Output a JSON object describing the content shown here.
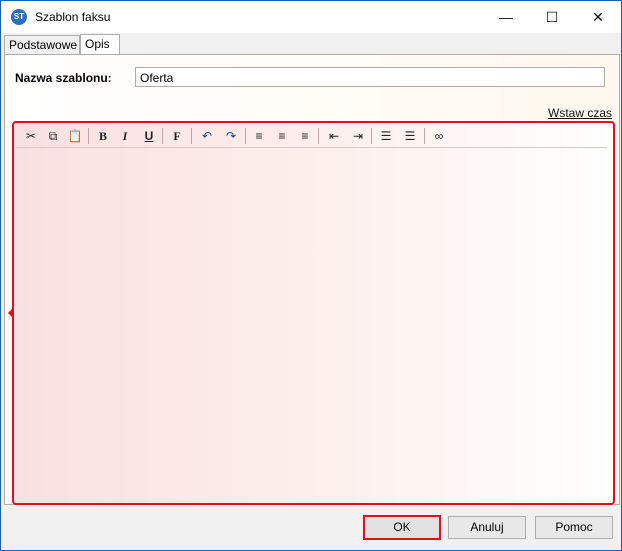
{
  "window": {
    "title": "Szablon faksu",
    "app_icon": "ST"
  },
  "titlebar_controls": {
    "minimize": "—",
    "maximize": "☐",
    "close": "✕"
  },
  "tabs": [
    {
      "label": "Podstawowe"
    },
    {
      "label": "Opis"
    }
  ],
  "form": {
    "name_label": "Nazwa szablonu:",
    "name_value": "Oferta"
  },
  "insert_time_link": "Wstaw czas",
  "toolbar": {
    "cut": "✂",
    "copy": "⧉",
    "paste": "📋",
    "bold": "B",
    "italic": "I",
    "underline": "U",
    "font": "F",
    "undo": "↶",
    "redo": "↷",
    "align_left": "≡",
    "align_center": "≡",
    "align_right": "≡",
    "outdent": "⇤",
    "indent": "⇥",
    "ordered_list": "☰",
    "unordered_list": "☰",
    "link": "∞"
  },
  "buttons": {
    "ok": "OK",
    "cancel": "Anuluj",
    "help": "Pomoc"
  }
}
